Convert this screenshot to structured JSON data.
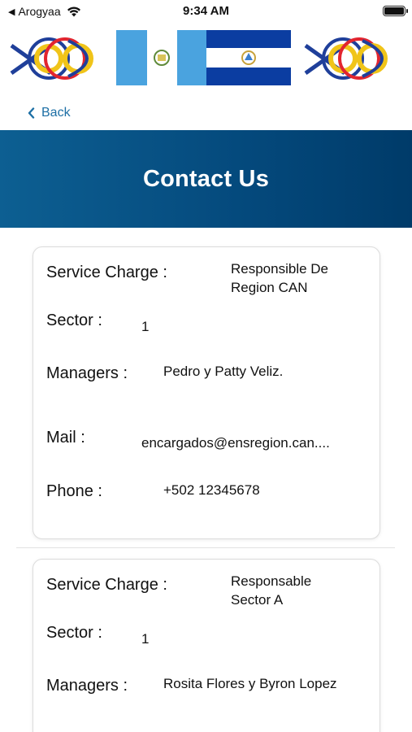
{
  "status": {
    "carrier": "Arogyaa",
    "time": "9:34 AM"
  },
  "nav": {
    "back_label": "Back"
  },
  "header": {
    "title": "Contact Us"
  },
  "labels": {
    "service_charge": "Service Charge :",
    "sector": "Sector :",
    "managers": "Managers :",
    "mail": "Mail :",
    "phone": "Phone :"
  },
  "contacts": [
    {
      "service_charge": "Responsible De Region CAN",
      "sector": "1",
      "managers": "Pedro y Patty Veliz.",
      "mail": "encargados@ensregion.can....",
      "phone": "+502 12345678"
    },
    {
      "service_charge": "Responsable Sector A",
      "sector": "1",
      "managers": "Rosita Flores y Byron Lopez"
    }
  ],
  "colors": {
    "header_gradient_start": "#0d5f92",
    "header_gradient_end": "#003b69",
    "link": "#1d6fa5"
  }
}
